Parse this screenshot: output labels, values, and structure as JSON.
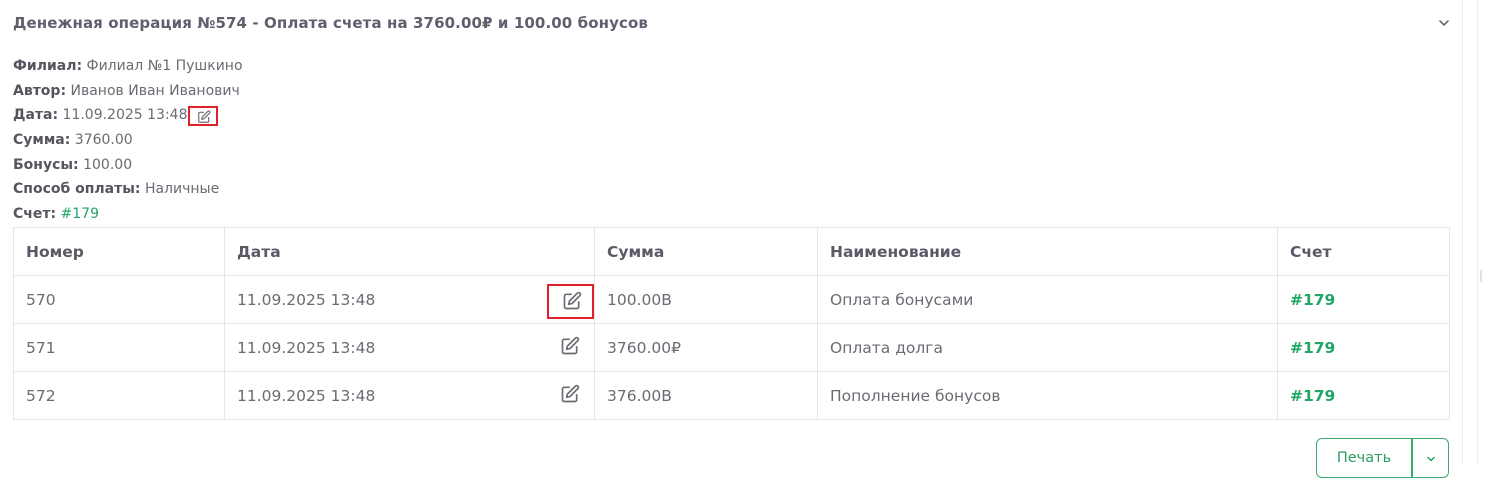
{
  "operation": {
    "title": "Денежная операция №574 - Оплата счета на 3760.00₽ и 100.00 бонусов",
    "expand_icon": "chevron-down-icon"
  },
  "details": {
    "branch_label": "Филиал:",
    "branch_value": "Филиал №1 Пушкино",
    "author_label": "Автор:",
    "author_value": "Иванов Иван Иванович",
    "date_label": "Дата:",
    "date_value": "11.09.2025 13:48",
    "sum_label": "Сумма:",
    "sum_value": "3760.00",
    "bonus_label": "Бонусы:",
    "bonus_value": "100.00",
    "pay_label": "Способ оплаты:",
    "pay_value": "Наличные",
    "invoice_label": "Счет:",
    "invoice_value": "#179"
  },
  "table": {
    "headers": [
      "Номер",
      "Дата",
      "Сумма",
      "Наименование",
      "Счет"
    ],
    "rows": [
      {
        "number": "570",
        "date": "11.09.2025 13:48",
        "sum": "100.00B",
        "name": "Оплата бонусами",
        "invoice": "#179"
      },
      {
        "number": "571",
        "date": "11.09.2025 13:48",
        "sum": "3760.00₽",
        "name": "Оплата долга",
        "invoice": "#179"
      },
      {
        "number": "572",
        "date": "11.09.2025 13:48",
        "sum": "376.00B",
        "name": "Пополнение бонусов",
        "invoice": "#179"
      }
    ]
  },
  "actions": {
    "print_label": "Печать",
    "print_dropdown_icon": "chevron-down-icon"
  },
  "colors": {
    "accent_green": "#22a565",
    "highlight_red": "#e0202a"
  }
}
